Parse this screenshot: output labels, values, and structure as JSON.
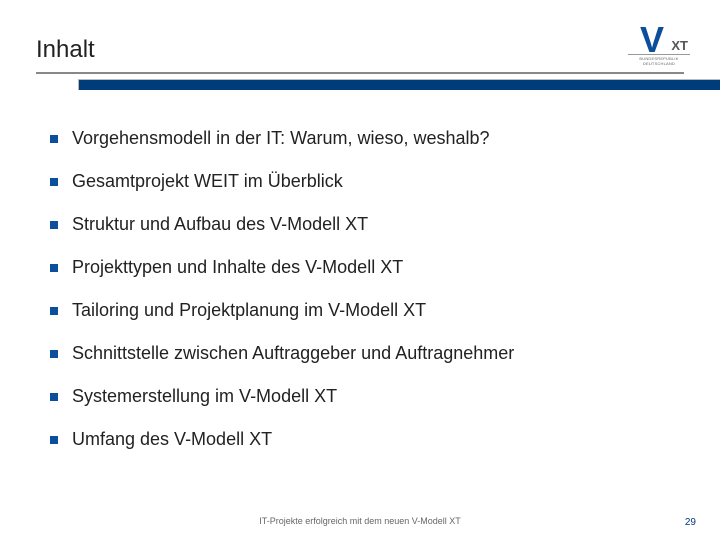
{
  "title": "Inhalt",
  "logo": {
    "xt": "XT",
    "subtitle": "BUNDESREPUBLIK DEUTSCHLAND"
  },
  "bullets": [
    "Vorgehensmodell in der IT: Warum, wieso, weshalb?",
    "Gesamtprojekt WEIT im Überblick",
    "Struktur und Aufbau des V-Modell XT",
    "Projekttypen und Inhalte des V-Modell XT",
    "Tailoring und Projektplanung im V-Modell XT",
    "Schnittstelle zwischen Auftraggeber und Auftragnehmer",
    "Systemerstellung im V-Modell XT",
    "Umfang des V-Modell XT"
  ],
  "footer": "IT-Projekte erfolgreich mit dem neuen V-Modell XT",
  "page": "29"
}
